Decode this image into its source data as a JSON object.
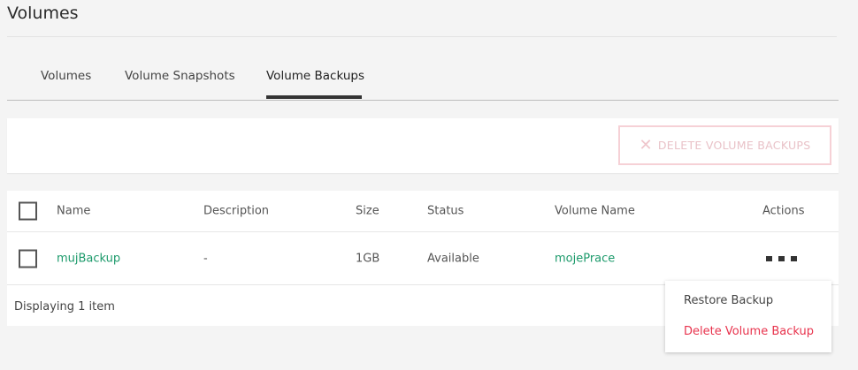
{
  "page": {
    "title": "Volumes"
  },
  "tabs": [
    {
      "label": "Volumes",
      "active": false
    },
    {
      "label": "Volume Snapshots",
      "active": false
    },
    {
      "label": "Volume Backups",
      "active": true
    }
  ],
  "toolbar": {
    "delete_label": "DELETE VOLUME BACKUPS",
    "delete_icon": "close-icon",
    "delete_enabled": false
  },
  "table": {
    "headers": {
      "name": "Name",
      "description": "Description",
      "size": "Size",
      "status": "Status",
      "volume_name": "Volume Name",
      "actions": "Actions"
    },
    "rows": [
      {
        "name": "mujBackup",
        "description": "-",
        "size": "1GB",
        "status": "Available",
        "volume_name": "mojePrace"
      }
    ],
    "footer": "Displaying 1 item"
  },
  "actions_menu": {
    "items": [
      {
        "label": "Restore Backup"
      },
      {
        "label": "Delete Volume Backup"
      }
    ]
  },
  "colors": {
    "link": "#1c9a6b",
    "danger": "#e8334d",
    "disabled_danger": "#f6d1d6"
  }
}
